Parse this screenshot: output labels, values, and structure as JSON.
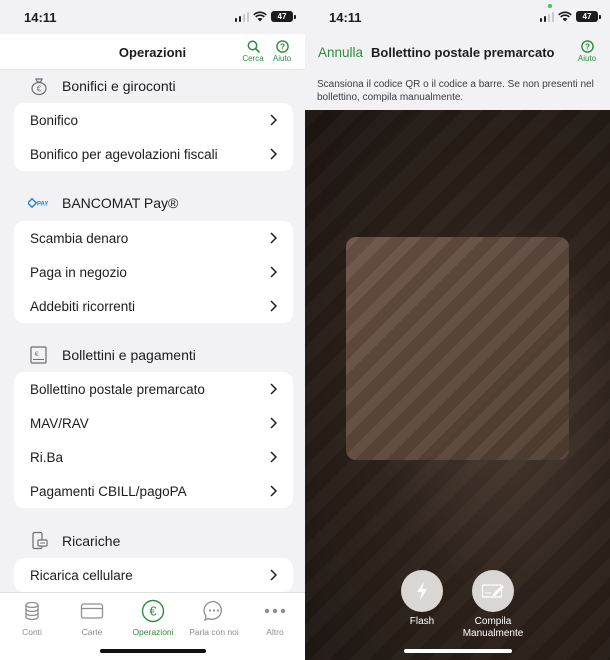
{
  "left_screen": {
    "status": {
      "time": "14:11",
      "battery": "47"
    },
    "navbar": {
      "title": "Operazioni",
      "search_label": "Cerca",
      "help_label": "Aiuto"
    },
    "sections": [
      {
        "title": "Bonifici e giroconti",
        "icon": "money-bag-icon",
        "items": [
          "Bonifico",
          "Bonifico per agevolazioni fiscali"
        ]
      },
      {
        "title": "BANCOMAT Pay®",
        "icon": "bancomat-pay-logo",
        "logo_text": "PAY",
        "items": [
          "Scambia denaro",
          "Paga in negozio",
          "Addebiti ricorrenti"
        ]
      },
      {
        "title": "Bollettini e pagamenti",
        "icon": "bill-icon",
        "items": [
          "Bollettino postale premarcato",
          "MAV/RAV",
          "Ri.Ba",
          "Pagamenti CBILL/pagoPA"
        ]
      },
      {
        "title": "Ricariche",
        "icon": "phone-topup-icon",
        "items": [
          "Ricarica cellulare"
        ]
      }
    ],
    "tabbar": [
      {
        "label": "Conti",
        "icon": "coins-icon",
        "active": false
      },
      {
        "label": "Carte",
        "icon": "card-icon",
        "active": false
      },
      {
        "label": "Operazioni",
        "icon": "euro-icon",
        "active": true
      },
      {
        "label": "Parla con noi",
        "icon": "chat-icon",
        "active": false
      },
      {
        "label": "Altro",
        "icon": "more-icon",
        "active": false
      }
    ]
  },
  "right_screen": {
    "status": {
      "time": "14:11",
      "battery": "47"
    },
    "navbar": {
      "cancel_label": "Annulla",
      "title": "Bollettino postale premarcato",
      "help_label": "Aiuto"
    },
    "instructions": "Scansiona il codice QR o il codice a barre. Se non presenti nel bollettino, compila manualmente.",
    "buttons": {
      "flash_label": "Flash",
      "manual_label_line1": "Compila",
      "manual_label_line2": "Manualmente"
    }
  },
  "colors": {
    "accent": "#2e8b3e",
    "background": "#f2f2f4",
    "camera": "#1b1410"
  }
}
